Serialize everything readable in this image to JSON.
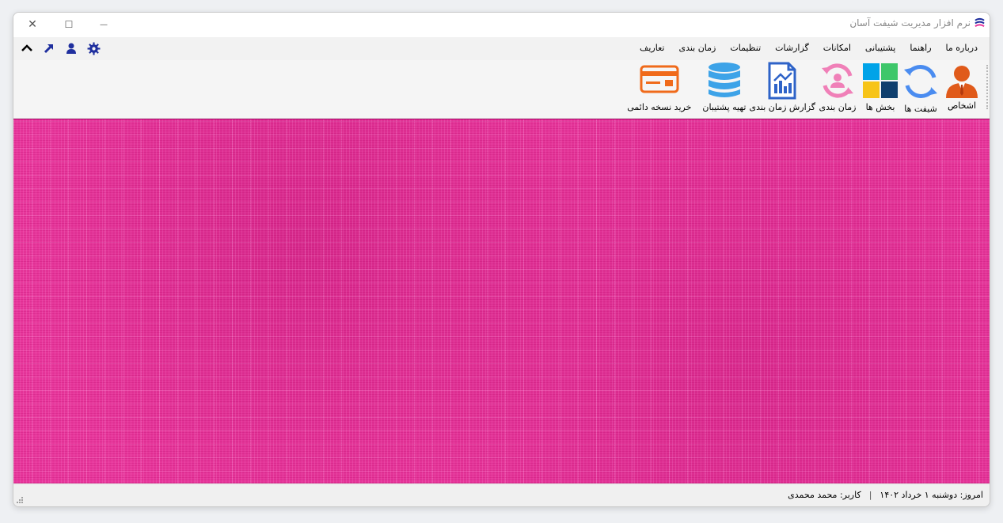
{
  "window": {
    "title": "نرم افزار مدیریت شیفت آسان",
    "controls": {
      "close": "✕",
      "maximize": "☐",
      "minimize": "—"
    }
  },
  "menu": {
    "items": [
      "تعاریف",
      "زمان بندی",
      "تنظیمات",
      "گزارشات",
      "امکانات",
      "پشتیبانی",
      "راهنما",
      "درباره ما"
    ]
  },
  "quick_tools": [
    "gear-icon",
    "user-icon",
    "arrow-up-right-icon",
    "chevron-up-icon"
  ],
  "toolbar": {
    "items": [
      {
        "label": "اشخاص",
        "icon": "person-icon"
      },
      {
        "label": "شیفت ها",
        "icon": "refresh-icon"
      },
      {
        "label": "بخش ها",
        "icon": "grid-icon"
      },
      {
        "label": "زمان بندی",
        "icon": "user-cycle-icon"
      },
      {
        "label": "گزارش زمان بندی",
        "icon": "report-icon"
      },
      {
        "label": "تهیه پشتیبان",
        "icon": "database-icon"
      },
      {
        "label": "خرید نسخه دائمی",
        "icon": "card-icon"
      }
    ]
  },
  "colors": {
    "background": "#e8389c",
    "accent_blue": "#1f2f9e",
    "person_orange": "#e05a1a",
    "refresh_blue": "#4a8cf0",
    "database_blue": "#3da3e8",
    "card_orange": "#f06a1a",
    "cycle_pink": "#f080b8"
  },
  "status": {
    "today": "امروز: دوشنبه ۱ خرداد ۱۴۰۲",
    "separator": "|",
    "user": "کاربر: محمد محمدی"
  }
}
